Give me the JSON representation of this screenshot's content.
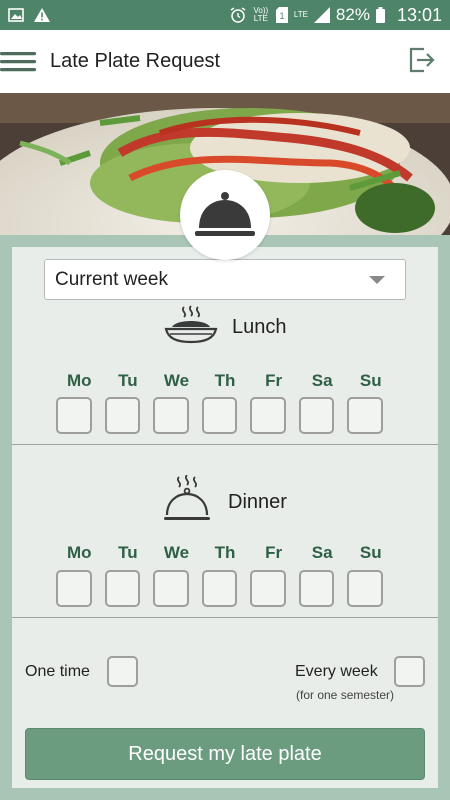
{
  "status_bar": {
    "battery": "82%",
    "time": "13:01",
    "volte": "Vo)) LTE",
    "lte": "LTE",
    "icons": [
      "image-icon",
      "warning-icon",
      "alarm-icon",
      "volte-icon",
      "sim-icon",
      "lte-signal-icon",
      "signal-icon",
      "battery-icon"
    ]
  },
  "app_bar": {
    "title": "Late Plate Request",
    "menu_icon": "hamburger-menu-icon",
    "logout_icon": "logout-icon"
  },
  "week_select": {
    "value": "Current week"
  },
  "lunch": {
    "label": "Lunch",
    "icon": "rice-bowl-icon",
    "days": [
      "Mo",
      "Tu",
      "We",
      "Th",
      "Fr",
      "Sa",
      "Su"
    ]
  },
  "dinner": {
    "label": "Dinner",
    "icon": "cloche-icon",
    "days": [
      "Mo",
      "Tu",
      "We",
      "Th",
      "Fr",
      "Sa",
      "Su"
    ]
  },
  "options": {
    "one_time": "One time",
    "every_week": "Every week",
    "every_week_note": "(for one semester)"
  },
  "submit": {
    "label": "Request my late plate"
  },
  "colors": {
    "status_bar": "#4e8468",
    "background": "#a9c5b6",
    "card": "#e8ede9",
    "day_text": "#2f6045",
    "button": "#6b9c80"
  }
}
